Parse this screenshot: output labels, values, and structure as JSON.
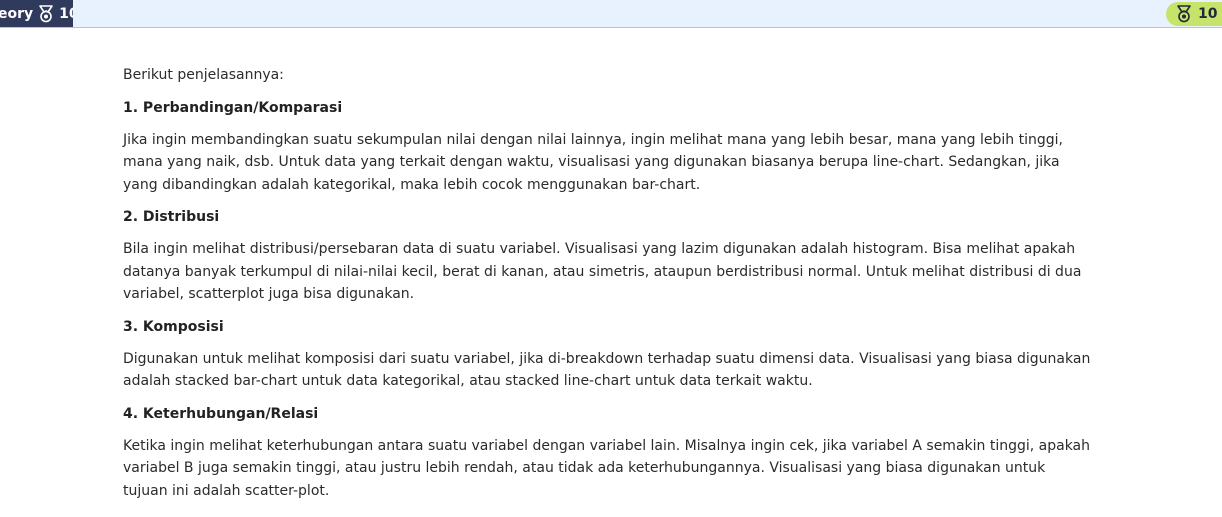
{
  "header": {
    "left_tab_text": "eory",
    "left_tab_count": "10",
    "xp_count": "10"
  },
  "article": {
    "intro": "Berikut penjelasannya:",
    "sections": [
      {
        "heading": "1. Perbandingan/Komparasi",
        "body": "Jika ingin membandingkan suatu sekumpulan nilai dengan nilai lainnya, ingin melihat mana yang lebih besar, mana yang lebih tinggi, mana yang naik, dsb. Untuk data yang terkait dengan waktu, visualisasi yang digunakan biasanya berupa line-chart. Sedangkan, jika yang dibandingkan adalah kategorikal, maka lebih cocok menggunakan bar-chart."
      },
      {
        "heading": "2. Distribusi",
        "body": "Bila ingin melihat distribusi/persebaran data di suatu variabel. Visualisasi yang lazim digunakan adalah histogram. Bisa melihat apakah datanya banyak terkumpul di nilai-nilai kecil, berat di kanan, atau simetris, ataupun berdistribusi normal. Untuk melihat distribusi di dua variabel, scatterplot juga bisa digunakan."
      },
      {
        "heading": "3. Komposisi",
        "body": "Digunakan untuk melihat komposisi dari suatu variabel, jika di-breakdown terhadap suatu dimensi data. Visualisasi yang biasa digunakan adalah stacked bar-chart untuk data kategorikal, atau stacked line-chart untuk data terkait waktu."
      },
      {
        "heading": "4. Keterhubungan/Relasi",
        "body": "Ketika ingin melihat keterhubungan antara suatu variabel dengan variabel lain. Misalnya ingin cek, jika variabel A semakin tinggi, apakah variabel B juga semakin tinggi, atau justru lebih rendah, atau tidak ada keterhubungannya. Visualisasi yang biasa digunakan untuk tujuan ini adalah scatter-plot."
      }
    ]
  },
  "colors": {
    "topbar_bg": "#e8f2fe",
    "left_tab_bg": "#2f3a5c",
    "xp_pill_bg": "#c7e36a"
  }
}
